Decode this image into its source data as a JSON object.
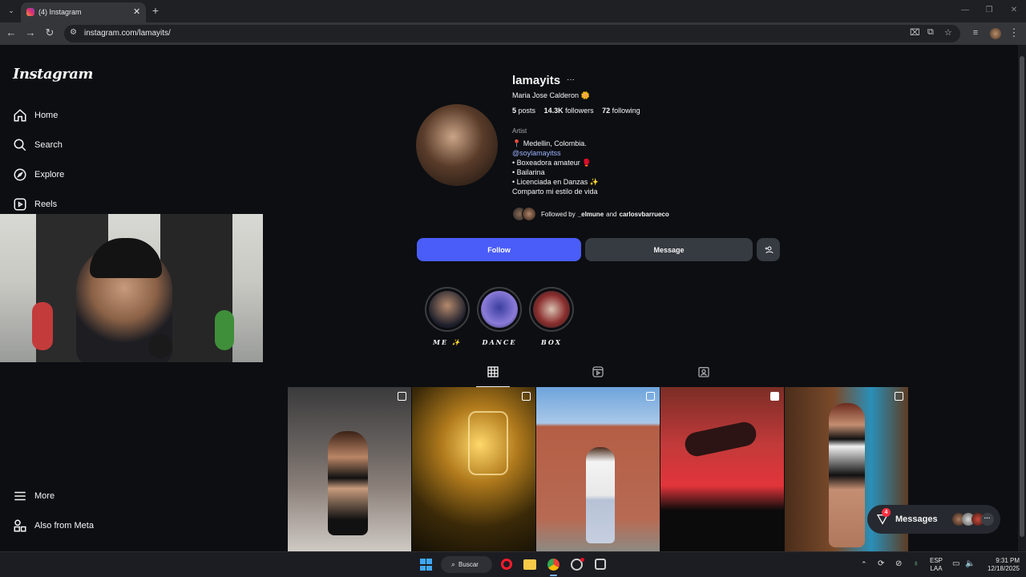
{
  "browser": {
    "tab_title": "(4) Instagram",
    "new_tab": "+",
    "url": "instagram.com/lamayits/"
  },
  "sidebar": {
    "logo": "Instagram",
    "items": [
      {
        "label": "Home",
        "icon": "home-icon"
      },
      {
        "label": "Search",
        "icon": "search-icon"
      },
      {
        "label": "Explore",
        "icon": "compass-icon"
      },
      {
        "label": "Reels",
        "icon": "reels-icon"
      }
    ],
    "bottom_items": [
      {
        "label": "More",
        "icon": "menu-icon"
      },
      {
        "label": "Also from Meta",
        "icon": "meta-icon"
      }
    ]
  },
  "profile": {
    "username": "lamayits",
    "options": "···",
    "full_name": "Maria Jose Calderon 🌼",
    "stats": {
      "posts_count": "5",
      "posts_label": "posts",
      "followers_count": "14.3K",
      "followers_label": "followers",
      "following_count": "72",
      "following_label": "following"
    },
    "category": "Artist",
    "bio": [
      "📍 Medellin, Colombia.",
      "@soylamayitss",
      "• Boxeadora amateur 🥊",
      "• Bailarina",
      "• Licenciada en Danzas ✨",
      "Comparto mi estilo de vida"
    ],
    "followed_by": {
      "prefix": "Followed by",
      "user1": "_elmune",
      "and": "and",
      "user2": "carlosvbarrueco"
    },
    "buttons": {
      "follow": "Follow",
      "message": "Message",
      "add_user_icon": "add-user-icon"
    }
  },
  "highlights": [
    {
      "label": "ME ✨"
    },
    {
      "label": "DANCE"
    },
    {
      "label": "BOX"
    }
  ],
  "messages_pill": {
    "label": "Messages",
    "badge": "4"
  },
  "taskbar": {
    "search": "Buscar",
    "lang_top": "ESP",
    "lang_bottom": "LAA",
    "time": "9:31 PM",
    "date": "12/18/2025"
  },
  "colors": {
    "follow_blue": "#4a5df9",
    "link_blue": "#9eb4ff",
    "message_btn": "#363a41"
  }
}
